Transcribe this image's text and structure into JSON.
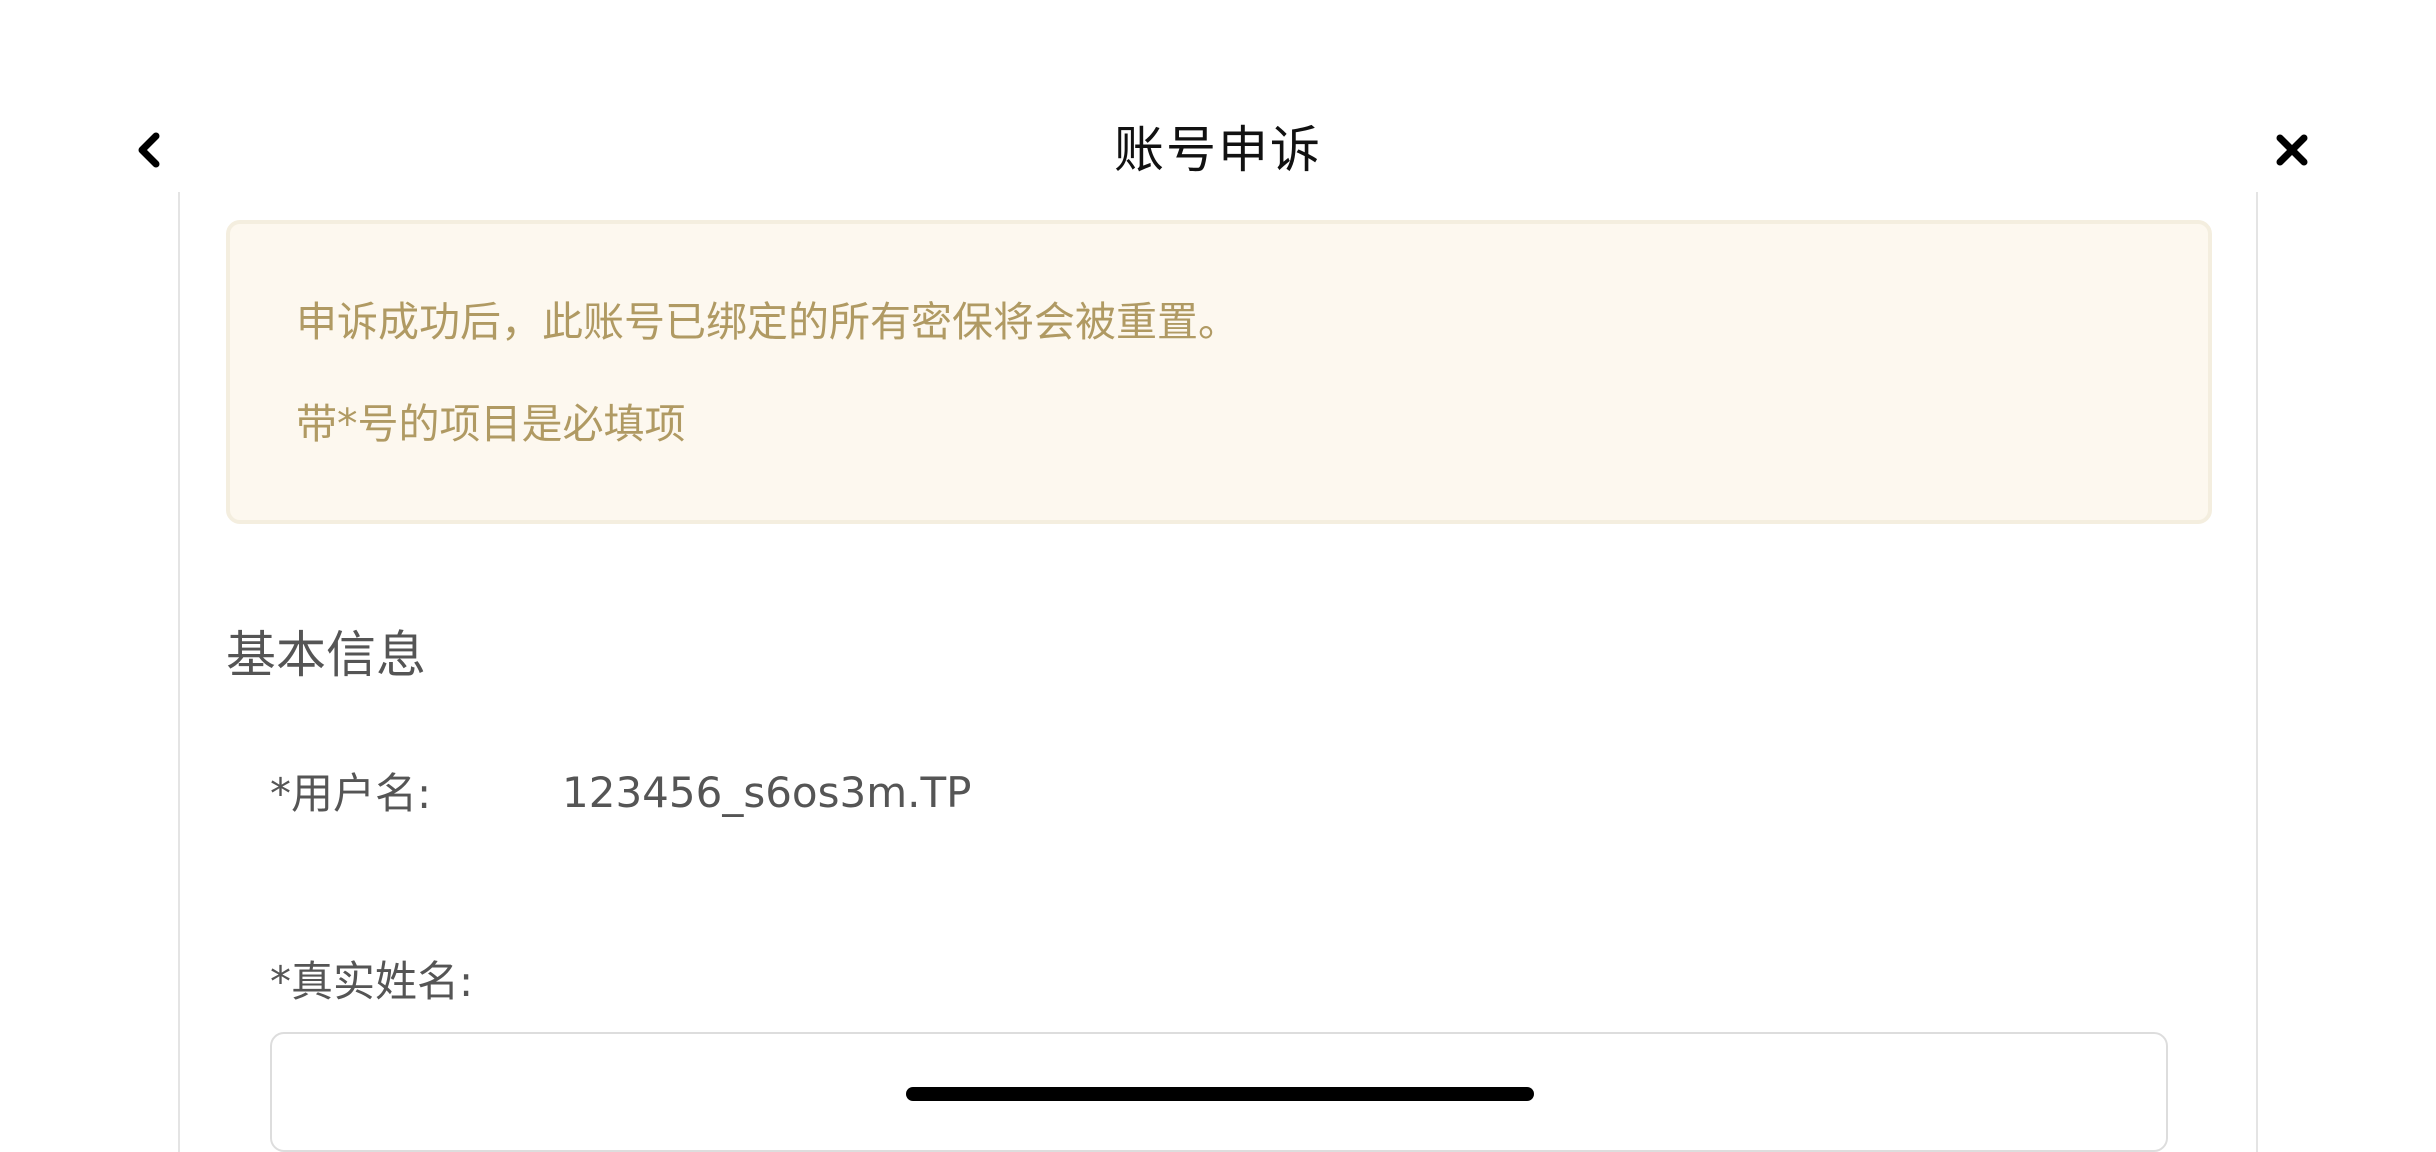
{
  "header": {
    "title": "账号申诉",
    "back_icon": "chevron-left-icon",
    "close_icon": "close-icon"
  },
  "notice": {
    "line1": "申诉成功后，此账号已绑定的所有密保将会被重置。",
    "line2": "带*号的项目是必填项"
  },
  "section": {
    "title": "基本信息"
  },
  "form": {
    "username": {
      "label": "*用户名:",
      "value": "123456_s6os3m.TP"
    },
    "real_name": {
      "label": "*真实姓名:",
      "value": "",
      "placeholder": ""
    }
  },
  "colors": {
    "notice_background": "#fdf8ef",
    "notice_border": "#f4eedf",
    "notice_text": "#b09a63",
    "label_text": "#555555",
    "title_text": "#111111"
  }
}
